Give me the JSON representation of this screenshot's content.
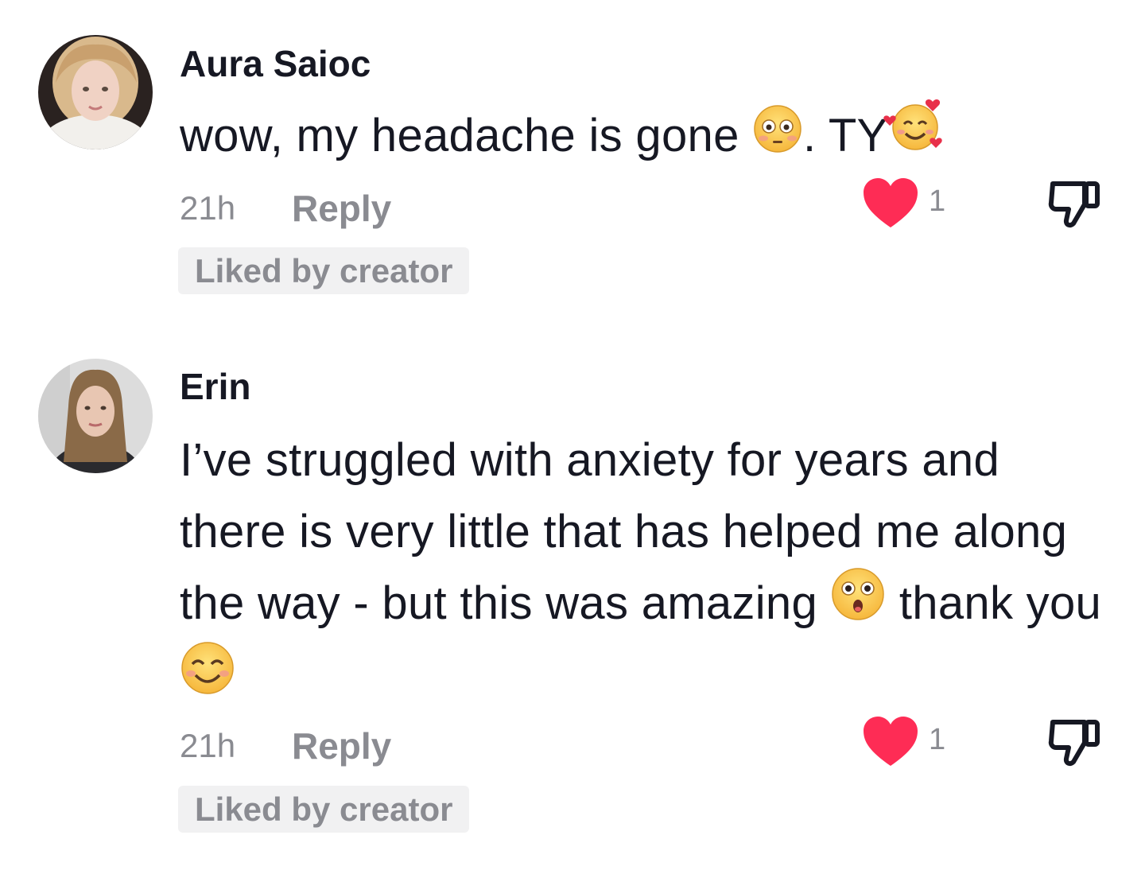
{
  "comments": [
    {
      "username": "Aura Saioc",
      "text_parts": [
        "wow, my headache is gone ",
        ". TY"
      ],
      "emojis": [
        "flushed-face-emoji",
        "smiling-face-with-hearts-emoji"
      ],
      "time": "21h",
      "reply_label": "Reply",
      "like_count": "1",
      "badge": "Liked by creator"
    },
    {
      "username": "Erin",
      "text_parts": [
        "I’ve struggled with anxiety for years and there is very little that has helped me along the way - but this was amazing ",
        " thank you "
      ],
      "emojis": [
        "astonished-face-emoji",
        "smiling-face-with-smiling-eyes-emoji"
      ],
      "time": "21h",
      "reply_label": "Reply",
      "like_count": "1",
      "badge": "Liked by creator"
    }
  ],
  "colors": {
    "text_primary": "#161823",
    "text_secondary": "#8a8b91",
    "like_red": "#fe2c55",
    "badge_bg": "#f1f1f2"
  }
}
